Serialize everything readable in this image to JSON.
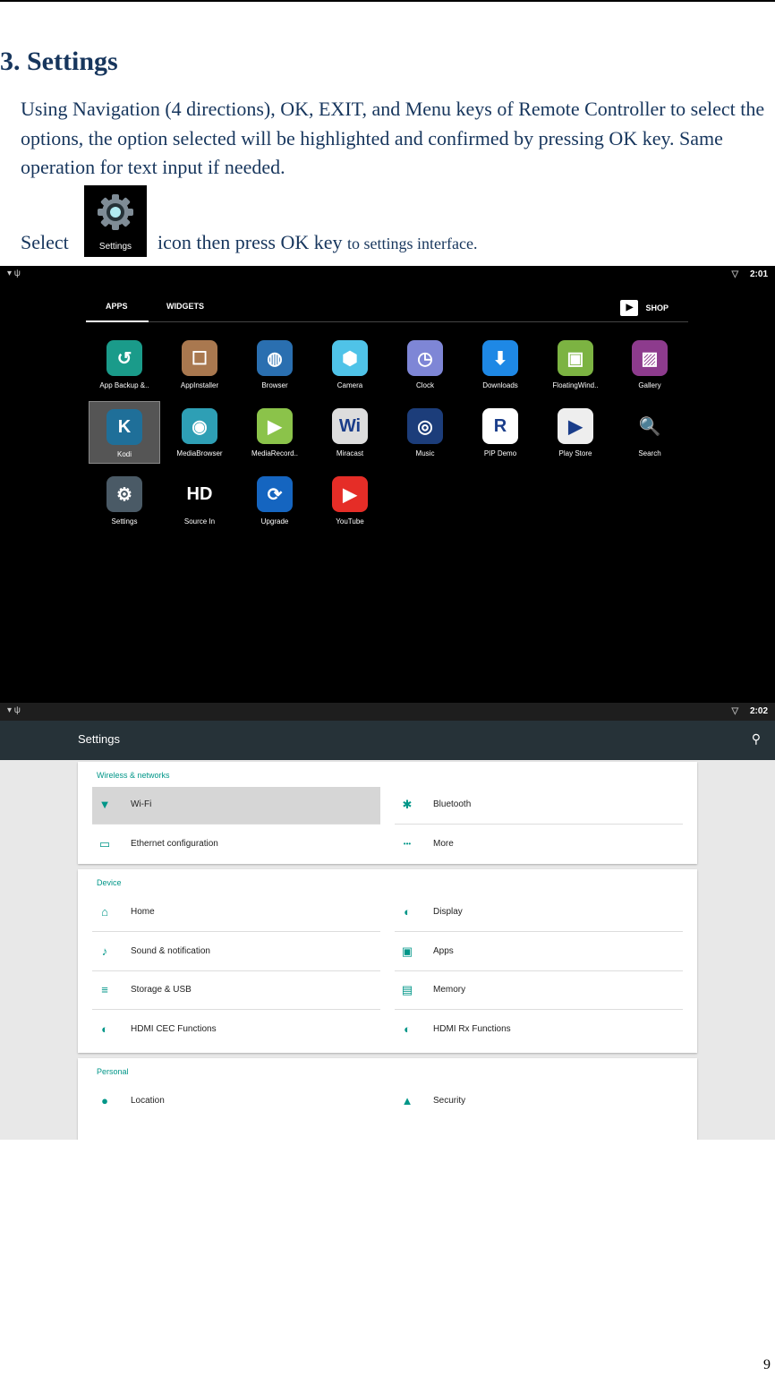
{
  "heading": "3. Settings",
  "paragraph": "Using Navigation (4 directions), OK, EXIT, and Menu keys of Remote Controller to select the options, the option selected will be highlighted and confirmed by pressing OK key. Same operation for text input if needed.",
  "select_prefix": "Select",
  "inline_icon_label": "Settings",
  "after_icon_text": "icon then press OK key",
  "after_icon_small": "to settings interface.",
  "shot1": {
    "time": "2:01",
    "tabs": [
      "APPS",
      "WIDGETS"
    ],
    "shop_label": "SHOP",
    "apps": [
      {
        "label": "App Backup &..",
        "icon": "backup-icon",
        "color": "#1a9b8a",
        "glyph": "↺"
      },
      {
        "label": "AppInstaller",
        "icon": "appinstaller-icon",
        "color": "#a9784f",
        "glyph": "☐"
      },
      {
        "label": "Browser",
        "icon": "browser-icon",
        "color": "#2a6fb0",
        "glyph": "◍"
      },
      {
        "label": "Camera",
        "icon": "camera-icon",
        "color": "#4fc3e8",
        "glyph": "⬢"
      },
      {
        "label": "Clock",
        "icon": "clock-icon",
        "color": "#7e86d6",
        "glyph": "◷"
      },
      {
        "label": "Downloads",
        "icon": "downloads-icon",
        "color": "#1e88e5",
        "glyph": "⬇"
      },
      {
        "label": "FloatingWind..",
        "icon": "android-icon",
        "color": "#7cb342",
        "glyph": "▣"
      },
      {
        "label": "Gallery",
        "icon": "gallery-icon",
        "color": "#8d3b8d",
        "glyph": "▨"
      },
      {
        "label": "Kodi",
        "icon": "kodi-icon",
        "color": "#1f6f99",
        "glyph": "K"
      },
      {
        "label": "MediaBrowser",
        "icon": "mediabrowser-icon",
        "color": "#2e9fb5",
        "glyph": "◉"
      },
      {
        "label": "MediaRecord..",
        "icon": "mediarecord-icon",
        "color": "#8bc34a",
        "glyph": "▶"
      },
      {
        "label": "Miracast",
        "icon": "miracast-icon",
        "color": "#dddddd",
        "glyph": "Wi"
      },
      {
        "label": "Music",
        "icon": "music-icon",
        "color": "#1c3d7a",
        "glyph": "◎"
      },
      {
        "label": "PIP Demo",
        "icon": "realtek-icon",
        "color": "#ffffff",
        "glyph": "R"
      },
      {
        "label": "Play Store",
        "icon": "playstore-icon",
        "color": "#eeeeee",
        "glyph": "▶"
      },
      {
        "label": "Search",
        "icon": "search-icon",
        "color": "#000000",
        "glyph": "🔍"
      },
      {
        "label": "Settings",
        "icon": "gear-icon",
        "color": "#4a5a66",
        "glyph": "⚙"
      },
      {
        "label": "Source In",
        "icon": "hdmi-icon",
        "color": "#000000",
        "glyph": "HD"
      },
      {
        "label": "Upgrade",
        "icon": "upgrade-icon",
        "color": "#1565c0",
        "glyph": "⟳"
      },
      {
        "label": "YouTube",
        "icon": "youtube-icon",
        "color": "#e52d27",
        "glyph": "▶"
      }
    ]
  },
  "shot2": {
    "time": "2:02",
    "title": "Settings",
    "sections": [
      {
        "title": "Wireless & networks",
        "items": [
          {
            "label": "Wi-Fi",
            "icon": "wifi-icon",
            "glyph": "▼"
          },
          {
            "label": "Bluetooth",
            "icon": "bluetooth-icon",
            "glyph": "✱"
          },
          {
            "label": "Ethernet configuration",
            "icon": "laptop-icon",
            "glyph": "▭"
          },
          {
            "label": "More",
            "icon": "more-icon",
            "glyph": "•••"
          }
        ]
      },
      {
        "title": "Device",
        "items": [
          {
            "label": "Home",
            "icon": "home-icon",
            "glyph": "⌂"
          },
          {
            "label": "Display",
            "icon": "display-icon",
            "glyph": "◐"
          },
          {
            "label": "Sound & notification",
            "icon": "bell-icon",
            "glyph": "♪"
          },
          {
            "label": "Apps",
            "icon": "android-icon",
            "glyph": "▣"
          },
          {
            "label": "Storage & USB",
            "icon": "storage-icon",
            "glyph": "≡"
          },
          {
            "label": "Memory",
            "icon": "memory-icon",
            "glyph": "▤"
          },
          {
            "label": "HDMI CEC Functions",
            "icon": "hdmi-cec-icon",
            "glyph": "◐"
          },
          {
            "label": "HDMI Rx Functions",
            "icon": "hdmi-rx-icon",
            "glyph": "◐"
          }
        ]
      },
      {
        "title": "Personal",
        "items": [
          {
            "label": "Location",
            "icon": "location-icon",
            "glyph": "●"
          },
          {
            "label": "Security",
            "icon": "lock-icon",
            "glyph": "▲"
          }
        ]
      }
    ]
  },
  "page_number": "9"
}
